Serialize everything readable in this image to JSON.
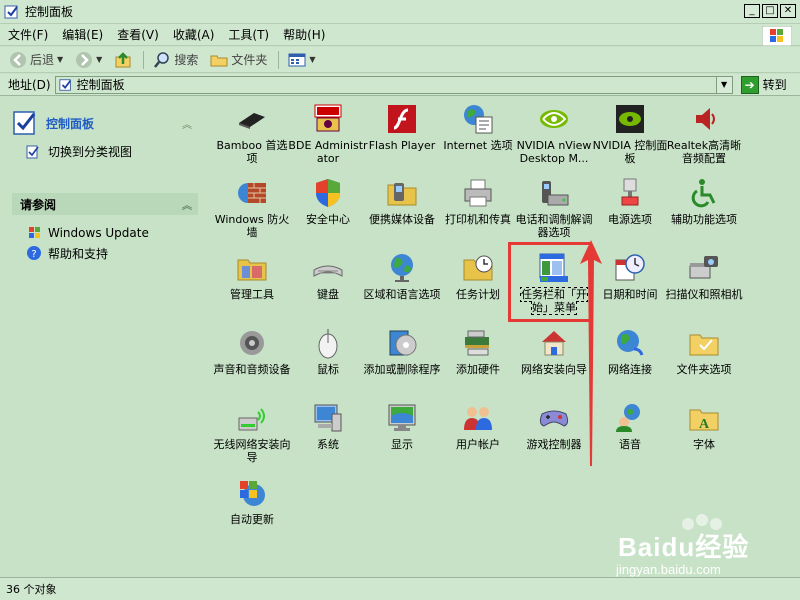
{
  "window": {
    "title": "控制面板",
    "buttons": [
      "_",
      "□",
      "✕"
    ]
  },
  "menubar": [
    "文件(F)",
    "编辑(E)",
    "查看(V)",
    "收藏(A)",
    "工具(T)",
    "帮助(H)"
  ],
  "toolbar": {
    "back": "后退",
    "search": "搜索",
    "folders": "文件夹"
  },
  "address": {
    "label": "地址(D)",
    "value": "控制面板",
    "go": "转到"
  },
  "leftpane": {
    "panel_title": "控制面板",
    "switch_view": "切换到分类视图",
    "see_also_title": "请参阅",
    "see_also": [
      "Windows Update",
      "帮助和支持"
    ]
  },
  "items": [
    "Bamboo 首选项",
    "BDE Administrator",
    "Flash Player",
    "Internet 选项",
    "NVIDIA nView Desktop M...",
    "NVIDIA 控制面板",
    "Realtek高清晰音频配置",
    "Windows 防火墙",
    "安全中心",
    "便携媒体设备",
    "打印机和传真",
    "电话和调制解调器选项",
    "电源选项",
    "辅助功能选项",
    "管理工具",
    "键盘",
    "区域和语言选项",
    "任务计划",
    "任务栏和「开始」菜单",
    "日期和时间",
    "扫描仪和照相机",
    "声音和音频设备",
    "鼠标",
    "添加或删除程序",
    "添加硬件",
    "网络安装向导",
    "网络连接",
    "文件夹选项",
    "无线网络安装向导",
    "系统",
    "显示",
    "用户帐户",
    "游戏控制器",
    "语音",
    "字体",
    "自动更新"
  ],
  "watermark": {
    "text": "Baidu经验",
    "sub": "jingyan.baidu.com"
  },
  "status": "36 个对象"
}
